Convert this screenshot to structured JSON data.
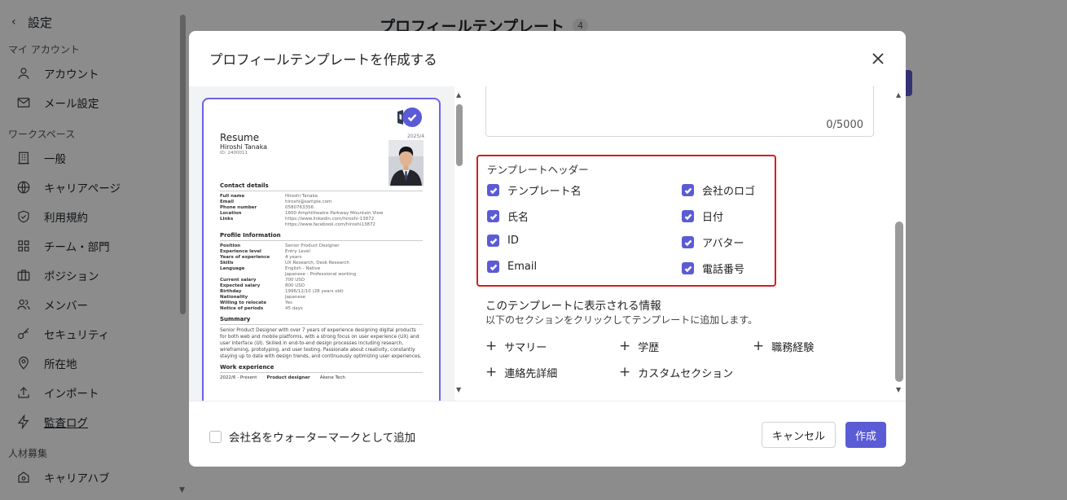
{
  "sidebar": {
    "back_label": "設定",
    "sections": {
      "account": "マイ アカウント",
      "workspace": "ワークスペース",
      "recruit": "人材募集"
    },
    "account_items": [
      {
        "label": "アカウント",
        "icon": "user-icon"
      },
      {
        "label": "メール設定",
        "icon": "mail-icon"
      }
    ],
    "workspace_items": [
      {
        "label": "一般",
        "icon": "building-icon"
      },
      {
        "label": "キャリアページ",
        "icon": "globe-icon"
      },
      {
        "label": "利用規約",
        "icon": "shield-icon"
      },
      {
        "label": "チーム・部門",
        "icon": "grid-icon"
      },
      {
        "label": "ポジション",
        "icon": "briefcase-icon"
      },
      {
        "label": "メンバー",
        "icon": "users-icon"
      },
      {
        "label": "セキュリティ",
        "icon": "key-icon"
      },
      {
        "label": "所在地",
        "icon": "location-icon"
      },
      {
        "label": "インポート",
        "icon": "upload-icon"
      },
      {
        "label": "監査ログ",
        "icon": "bolt-icon"
      }
    ],
    "recruit_items": [
      {
        "label": "キャリアハブ",
        "icon": "hub-icon"
      }
    ]
  },
  "page": {
    "title": "プロフィールテンプレート",
    "count": "4"
  },
  "modal": {
    "title": "プロフィールテンプレートを作成する",
    "counter": "0/5000",
    "header_label": "テンプレートヘッダー",
    "header_options": [
      {
        "label": "テンプレート名",
        "checked": true
      },
      {
        "label": "会社のロゴ",
        "checked": true
      },
      {
        "label": "氏名",
        "checked": true
      },
      {
        "label": "日付",
        "checked": true
      },
      {
        "label": "ID",
        "checked": true
      },
      {
        "label": "アバター",
        "checked": true
      },
      {
        "label": "Email",
        "checked": true
      },
      {
        "label": "電話番号",
        "checked": true
      }
    ],
    "info_title": "このテンプレートに表示される情報",
    "info_sub": "以下のセクションをクリックしてテンプレートに追加します。",
    "sections": [
      "サマリー",
      "学歴",
      "職務経験",
      "連絡先詳細",
      "カスタムセクション"
    ],
    "watermark_label": "会社名をウォーターマークとして追加",
    "cancel_label": "キャンセル",
    "create_label": "作成",
    "accent_color": "#5b5bd6",
    "highlight_color": "#d21f1f"
  },
  "resume": {
    "date": "2025/4",
    "title": "Resume",
    "name": "Hiroshi Tanaka",
    "id": "ID: 2400011",
    "contact_heading": "Contact details",
    "contact": [
      {
        "k": "Full name",
        "v": "Hiroshi Tanaka"
      },
      {
        "k": "Email",
        "v": "hiroshi@sample.com"
      },
      {
        "k": "Phone number",
        "v": "0580763356"
      },
      {
        "k": "Location",
        "v": "1600 Amphitheatre Parkway Mountain View"
      },
      {
        "k": "Links",
        "v": "https://www.linkedin.com/hiroshi-13872"
      },
      {
        "k": "",
        "v": "https://www.facebook.com/hiroshi13872"
      }
    ],
    "profile_heading": "Profile Information",
    "profile": [
      {
        "k": "Position",
        "v": "Senior Product Designer"
      },
      {
        "k": "Experience level",
        "v": "Entry Level"
      },
      {
        "k": "Years of experience",
        "v": "4 years"
      },
      {
        "k": "Skills",
        "v": "UX Research, Desk Research"
      },
      {
        "k": "Language",
        "v": "English - Native"
      },
      {
        "k": "",
        "v": "Japanese - Professional working"
      },
      {
        "k": "Current salary",
        "v": "700 USD"
      },
      {
        "k": "Expected salary",
        "v": "800 USD"
      },
      {
        "k": "Birthday",
        "v": "1996/12/10 (28 years old)"
      },
      {
        "k": "Nationality",
        "v": "Japanese"
      },
      {
        "k": "Willing to relocate",
        "v": "Yes"
      },
      {
        "k": "Notice of periods",
        "v": "45 days"
      }
    ],
    "summary_heading": "Summary",
    "summary": "Senior Product Designer with over 7 years of experience designing digital products for both web and mobile platforms, with a strong focus on user experience (UX) and user interface (UI). Skilled in end-to-end design processes including research, wireframing, prototyping, and user testing. Passionate about creativity, constantly staying up to date with design trends, and continuously optimizing user experiences.",
    "work_heading": "Work experience",
    "work_period": "2022/6 - Present",
    "work_role": "Product designer",
    "work_company": "Akene Tech"
  }
}
